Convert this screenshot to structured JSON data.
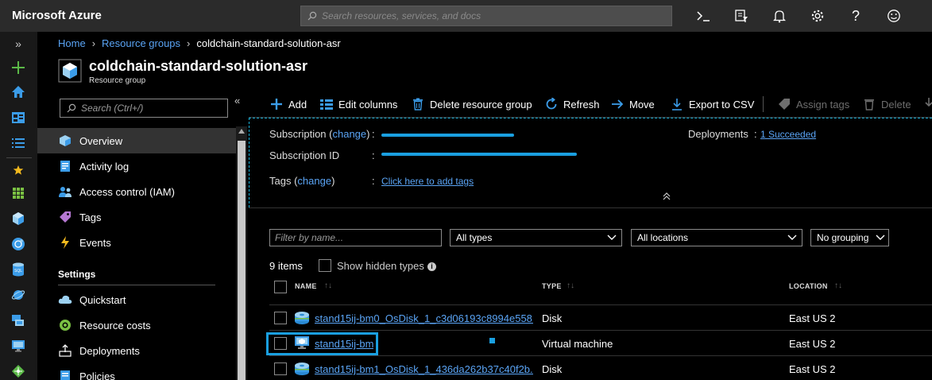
{
  "app": {
    "brand": "Microsoft Azure",
    "search_placeholder": "Search resources, services, and docs"
  },
  "topbar_icons": [
    "cloud-shell-icon",
    "directory-filter-icon",
    "notifications-icon",
    "settings-icon",
    "help-icon",
    "feedback-icon"
  ],
  "breadcrumb": {
    "home": "Home",
    "resource_groups": "Resource groups",
    "current": "coldchain-standard-solution-asr"
  },
  "header": {
    "title": "coldchain-standard-solution-asr",
    "subtitle": "Resource group"
  },
  "menu": {
    "search_placeholder": "Search (Ctrl+/)",
    "collapse": "«",
    "items": [
      {
        "label": "Overview",
        "icon": "overview-icon"
      },
      {
        "label": "Activity log",
        "icon": "activity-log-icon"
      },
      {
        "label": "Access control (IAM)",
        "icon": "access-control-icon"
      },
      {
        "label": "Tags",
        "icon": "tag-icon"
      },
      {
        "label": "Events",
        "icon": "events-icon"
      }
    ],
    "settings_heading": "Settings",
    "settings_items": [
      {
        "label": "Quickstart",
        "icon": "quickstart-icon"
      },
      {
        "label": "Resource costs",
        "icon": "resource-costs-icon"
      },
      {
        "label": "Deployments",
        "icon": "deployments-icon"
      },
      {
        "label": "Policies",
        "icon": "policies-icon"
      }
    ]
  },
  "commands": {
    "add": "Add",
    "edit_columns": "Edit columns",
    "delete_rg": "Delete resource group",
    "refresh": "Refresh",
    "move": "Move",
    "export": "Export to CSV",
    "assign_tags": "Assign tags",
    "delete": "Delete"
  },
  "essentials": {
    "subscription_label": "Subscription (",
    "change": "change",
    "close_paren": ")",
    "subscription_id_label": "Subscription ID",
    "tags_label": "Tags (",
    "tags_value": "Click here to add tags",
    "deployments_label": "Deployments",
    "deployments_value": "1 Succeeded",
    "colon": ":",
    "collapse_chevron": "⌃"
  },
  "filters": {
    "name_placeholder": "Filter by name...",
    "types": "All types",
    "locations": "All locations",
    "grouping": "No grouping"
  },
  "list": {
    "count": "9 items",
    "show_hidden": "Show hidden types",
    "info": "i",
    "columns": {
      "name": "NAME",
      "type": "TYPE",
      "location": "LOCATION",
      "sort": "↑↓"
    },
    "rows": [
      {
        "name": "stand15ij-bm0_OsDisk_1_c3d06193c8994e558...",
        "type": "Disk",
        "location": "East US 2",
        "icon": "disk-icon"
      },
      {
        "name": "stand15ij-bm",
        "type": "Virtual machine",
        "location": "East US 2",
        "icon": "virtual-machine-icon"
      },
      {
        "name": "stand15ij-bm1_OsDisk_1_436da262b37c40f2b...",
        "type": "Disk",
        "location": "East US 2",
        "icon": "disk-icon"
      }
    ]
  },
  "colors": {
    "accent": "#1a9fe0",
    "link": "#5aa4f5",
    "topbar": "#2b2b2b",
    "background": "#000000"
  }
}
